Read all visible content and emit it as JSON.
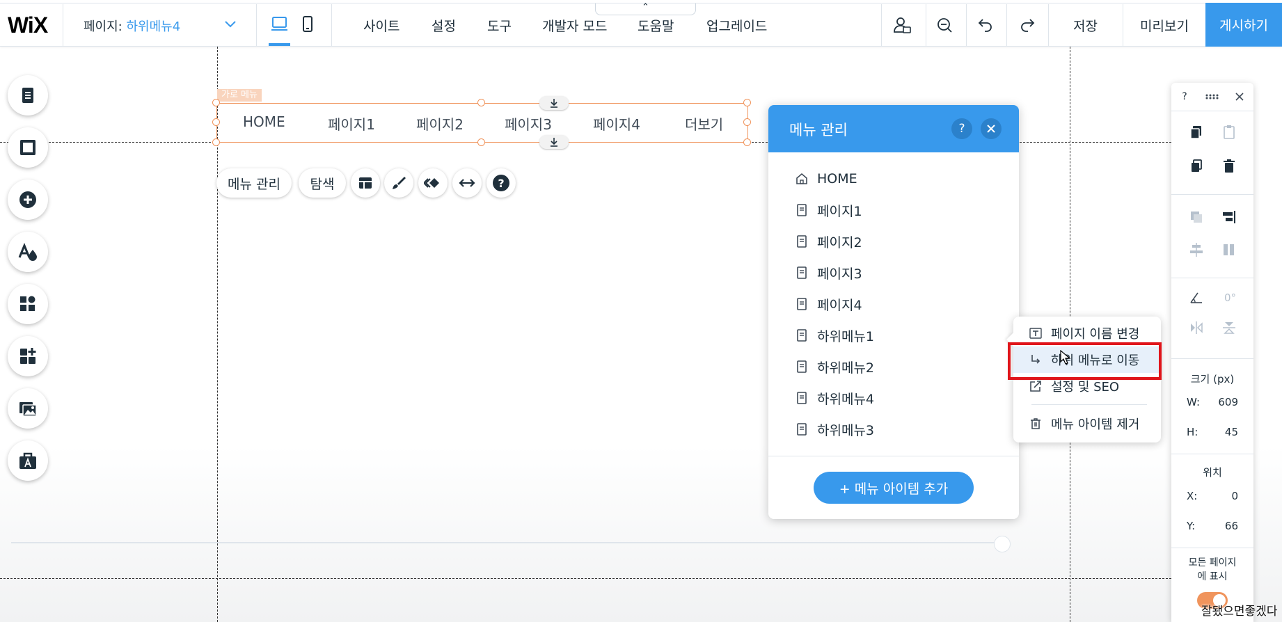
{
  "topbar": {
    "logo": "WiX",
    "page_label": "페이지:",
    "page_name": "하위메뉴4",
    "menu": [
      "사이트",
      "설정",
      "도구",
      "개발자 모드",
      "도움말",
      "업그레이드"
    ],
    "collapse_glyph": "⌃",
    "save": "저장",
    "preview": "미리보기",
    "publish": "게시하기"
  },
  "canvas": {
    "component_label": "가로 메뉴",
    "nav_items": [
      "HOME",
      "페이지1",
      "페이지2",
      "페이지3",
      "페이지4",
      "더보기"
    ],
    "toolbar": {
      "manage_menu": "메뉴 관리",
      "navigate": "탐색"
    }
  },
  "menu_manager": {
    "title": "메뉴 관리",
    "help": "?",
    "items": [
      "HOME",
      "페이지1",
      "페이지2",
      "페이지3",
      "페이지4",
      "하위메뉴1",
      "하위메뉴2",
      "하위메뉴4",
      "하위메뉴3"
    ],
    "add_button": "+ 메뉴 아이템 추가"
  },
  "context_menu": {
    "items": [
      "페이지 이름 변경",
      "하위 메뉴로 이동",
      "설정 및 SEO",
      "메뉴 아이템 제거"
    ],
    "highlighted_index": 1
  },
  "inspector": {
    "help": "?",
    "rotation": "0°",
    "size_label": "크기 (px)",
    "w_label": "W:",
    "w_value": "609",
    "h_label": "H:",
    "h_value": "45",
    "position_label": "위치",
    "x_label": "X:",
    "x_value": "0",
    "y_label": "Y:",
    "y_value": "66",
    "show_all_label_1": "모든 페이지",
    "show_all_label_2": "에 표시",
    "show_all_on": true
  },
  "overlay_text": "잘됐으면좋겠다",
  "colors": {
    "accent": "#3899ec",
    "selection": "#f0945c",
    "highlight_box": "#e0151a"
  }
}
